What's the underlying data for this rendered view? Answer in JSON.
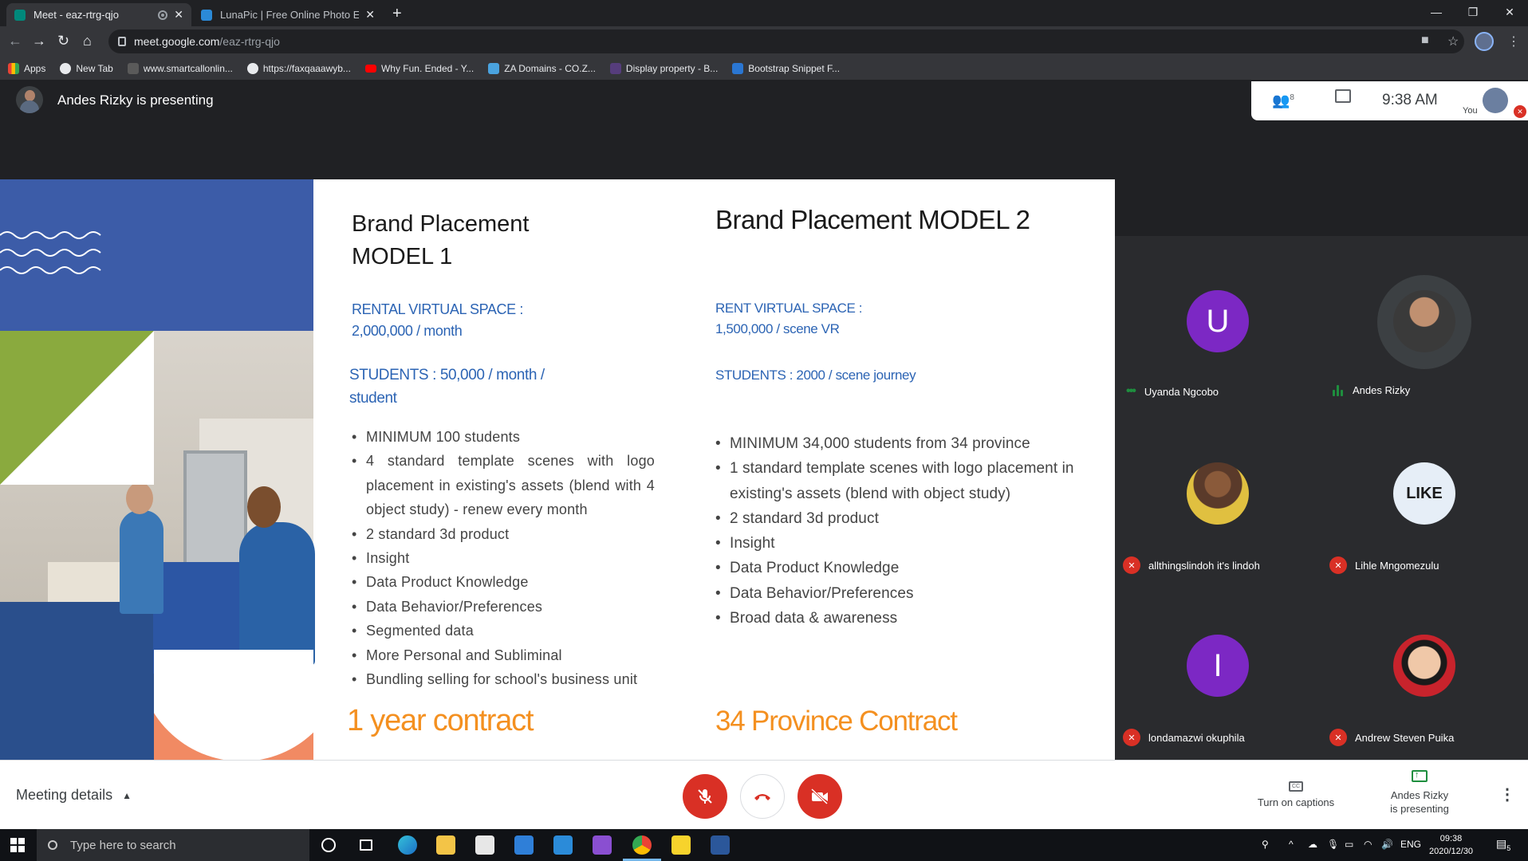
{
  "browser": {
    "tabs": [
      {
        "title": "Meet - eaz-rtrg-qjo",
        "active": true
      },
      {
        "title": "LunaPic | Free Online Photo Editor",
        "active": false
      }
    ],
    "url_host": "meet.google.com",
    "url_path": "/eaz-rtrg-qjo",
    "bookmarks": [
      {
        "label": "Apps",
        "icon": "apps-grid-icon"
      },
      {
        "label": "New Tab",
        "icon": "globe-icon"
      },
      {
        "label": "www.smartcallonlin...",
        "icon": "smartcall-icon"
      },
      {
        "label": "https://faxqaaawyb...",
        "icon": "globe-icon"
      },
      {
        "label": "Why Fun. Ended - Y...",
        "icon": "youtube-icon"
      },
      {
        "label": "ZA Domains - CO.Z...",
        "icon": "zadomains-icon"
      },
      {
        "label": "Display property - B...",
        "icon": "bootstrap-icon"
      },
      {
        "label": "Bootstrap Snippet F...",
        "icon": "snippet-icon"
      }
    ]
  },
  "meet": {
    "presenting_label": "Andes Rizky is presenting",
    "participant_count": "8",
    "time": "9:38 AM",
    "you_label": "You",
    "meeting_details_label": "Meeting details",
    "captions_label": "Turn on captions",
    "presenting_button_line1": "Andes Rizky",
    "presenting_button_line2": "is presenting",
    "participants": [
      {
        "name": "Uyanda Ngcobo",
        "avatar_letter": "U",
        "status": "more-options"
      },
      {
        "name": "Andes Rizky",
        "status": "speaking"
      },
      {
        "name": "allthingslindoh it's lindoh",
        "status": "muted"
      },
      {
        "name": "Lihle Mngomezulu",
        "avatar_text": "LIKE",
        "status": "muted"
      },
      {
        "name": "londamazwi okuphila",
        "avatar_letter": "I",
        "status": "muted"
      },
      {
        "name": "Andrew Steven Puika",
        "status": "muted"
      }
    ]
  },
  "slide": {
    "model1": {
      "title_line1": "Brand Placement",
      "title_line2": "MODEL 1",
      "rental_line1": "RENTAL VIRTUAL SPACE :",
      "rental_line2": "2,000,000 / month",
      "students_line1": "STUDENTS : 50,000 /  month  /",
      "students_line2": "student",
      "bullets": [
        "MINIMUM 100 students",
        "4 standard template scenes with logo placement in existing's assets (blend with 4 object study) - renew every month",
        "2 standard 3d product",
        "Insight",
        "Data Product Knowledge",
        "Data Behavior/Preferences",
        "Segmented data",
        "More Personal and Subliminal",
        "Bundling selling for school's business unit"
      ],
      "contract": "1 year contract"
    },
    "model2": {
      "title": "Brand Placement MODEL 2",
      "rent_line1": "RENT VIRTUAL SPACE :",
      "rent_line2": "1,500,000 / scene VR",
      "students": "STUDENTS : 2000 / scene journey",
      "bullets": [
        "MINIMUM 34,000 students from 34 province",
        " 1 standard template scenes with logo placement in existing's assets (blend with object study)",
        "2 standard 3d product",
        "Insight",
        "Data Product Knowledge",
        "Data Behavior/Preferences",
        "Broad data & awareness"
      ],
      "contract": "34 Province Contract"
    },
    "colors": {
      "blue_text": "#2c64b4",
      "orange": "#f49020",
      "blue_panel": "#3c5ca8",
      "green": "#8aaa3e",
      "coral": "#f18a63"
    }
  },
  "taskbar": {
    "search_placeholder": "Type here to search",
    "language": "ENG",
    "clock_time": "09:38",
    "clock_date": "2020/12/30",
    "notification_count": "5"
  },
  "colors": {
    "meet_red": "#d93025",
    "meet_green": "#1e8e3e",
    "avatar_purple": "#7c28c4"
  }
}
